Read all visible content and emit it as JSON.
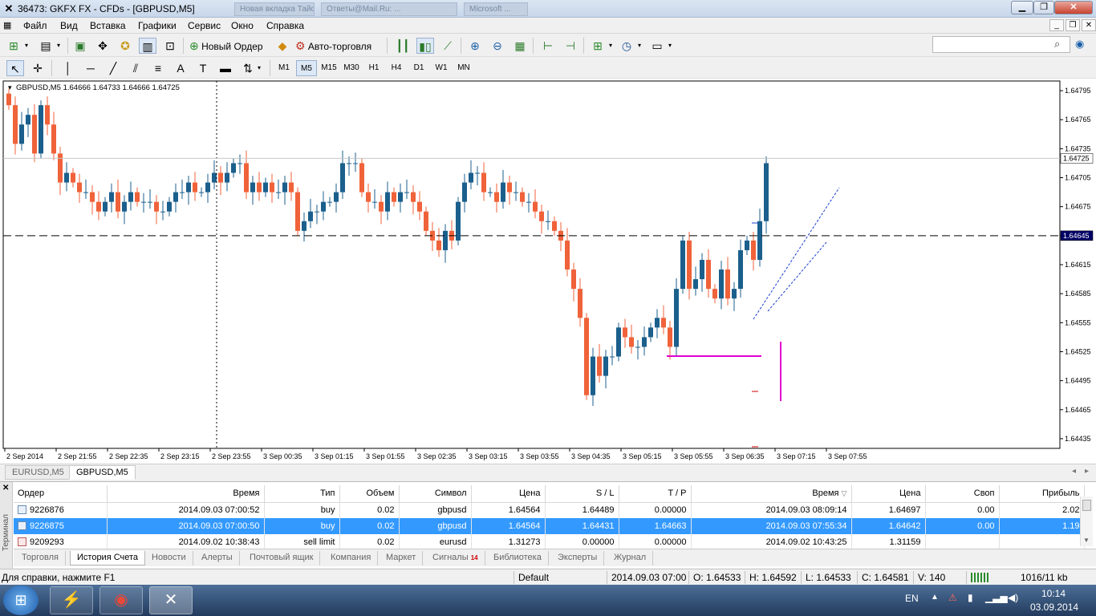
{
  "window": {
    "title": "36473: GKFX FX - CFDs - [GBPUSD,M5]",
    "icon": "metatrader-icon",
    "bg_tab_1": "Новая вкладка Тайфун...",
    "bg_tab_2": "Ответы@Mail.Ru: ...",
    "bg_tab_3": "Microsoft ..."
  },
  "menu": [
    "Файл",
    "Вид",
    "Вставка",
    "Графики",
    "Сервис",
    "Окно",
    "Справка"
  ],
  "toolbar": {
    "new_order": "Новый Ордер",
    "auto_trading": "Авто-торговля"
  },
  "timeframes": [
    "M1",
    "M5",
    "M15",
    "M30",
    "H1",
    "H4",
    "D1",
    "W1",
    "MN"
  ],
  "active_timeframe": "M5",
  "search": {
    "placeholder": ""
  },
  "chart_header": "GBPUSD,M5  1.64666 1.64733 1.64666 1.64725",
  "chart_data": {
    "type": "candlestick",
    "symbol": "GBPUSD",
    "timeframe": "M5",
    "ohlc_header": {
      "open": 1.64666,
      "high": 1.64733,
      "low": 1.64666,
      "close": 1.64725
    },
    "ylim": [
      1.64425,
      1.64805
    ],
    "y_ticks": [
      1.64795,
      1.64765,
      1.64735,
      1.64705,
      1.64675,
      1.64645,
      1.64615,
      1.64585,
      1.64555,
      1.64525,
      1.64495,
      1.64465,
      1.64435
    ],
    "x_ticks": [
      "2 Sep 2014",
      "2 Sep 21:55",
      "2 Sep 22:35",
      "2 Sep 23:15",
      "2 Sep 23:55",
      "3 Sep 00:35",
      "3 Sep 01:15",
      "3 Sep 01:55",
      "3 Sep 02:35",
      "3 Sep 03:15",
      "3 Sep 03:55",
      "3 Sep 04:35",
      "3 Sep 05:15",
      "3 Sep 05:55",
      "3 Sep 06:35",
      "3 Sep 07:15",
      "3 Sep 07:55"
    ],
    "current_price": 1.64725,
    "hline_price": 1.64645,
    "current_price_label": "1.64725",
    "hline_label": "1.64645",
    "bull_color": "#1b5f8c",
    "bear_color": "#f0623a",
    "closes": [
      1.6478,
      1.6474,
      1.6476,
      1.6477,
      1.6473,
      1.6478,
      1.6476,
      1.6473,
      1.647,
      1.6471,
      1.647,
      1.6469,
      1.6469,
      1.6468,
      1.6467,
      1.6468,
      1.6469,
      1.6467,
      1.6468,
      1.6469,
      1.6468,
      1.6468,
      1.6468,
      1.6467,
      1.6467,
      1.6468,
      1.6469,
      1.6469,
      1.647,
      1.6469,
      1.6469,
      1.647,
      1.6471,
      1.647,
      1.6471,
      1.6472,
      1.6472,
      1.6469,
      1.647,
      1.6469,
      1.647,
      1.6469,
      1.6469,
      1.647,
      1.6469,
      1.6465,
      1.6466,
      1.6467,
      1.6467,
      1.6468,
      1.6468,
      1.6469,
      1.6472,
      1.6472,
      1.6472,
      1.6469,
      1.6468,
      1.6468,
      1.6467,
      1.6469,
      1.6468,
      1.6469,
      1.6469,
      1.6468,
      1.6467,
      1.6465,
      1.6464,
      1.6463,
      1.6465,
      1.6464,
      1.6468,
      1.647,
      1.6471,
      1.6471,
      1.6469,
      1.6469,
      1.6468,
      1.647,
      1.6469,
      1.6469,
      1.6468,
      1.6468,
      1.6467,
      1.6466,
      1.6466,
      1.6465,
      1.6464,
      1.6461,
      1.6459,
      1.6456,
      1.6448,
      1.6452,
      1.645,
      1.6452,
      1.6452,
      1.6455,
      1.6454,
      1.6453,
      1.6453,
      1.6454,
      1.6455,
      1.6456,
      1.6455,
      1.6453,
      1.6459,
      1.6464,
      1.6459,
      1.646,
      1.6462,
      1.6459,
      1.6458,
      1.6461,
      1.6458,
      1.6459,
      1.6463,
      1.6464,
      1.6462,
      1.6466,
      1.6472
    ]
  },
  "chart_tabs": [
    "EURUSD,M5",
    "GBPUSD,M5"
  ],
  "active_chart_tab": 1,
  "orders": {
    "headers": [
      "Ордер",
      "Время",
      "Тип",
      "Объем",
      "Символ",
      "Цена",
      "S / L",
      "T / P",
      "Время",
      "Цена",
      "Своп",
      "Прибыль"
    ],
    "rows": [
      [
        "9226876",
        "2014.09.03 07:00:52",
        "buy",
        "0.02",
        "gbpusd",
        "1.64564",
        "1.64489",
        "0.00000",
        "2014.09.03 08:09:14",
        "1.64697",
        "0.00",
        "2.02"
      ],
      [
        "9226875",
        "2014.09.03 07:00:50",
        "buy",
        "0.02",
        "gbpusd",
        "1.64564",
        "1.64431",
        "1.64663",
        "2014.09.03 07:55:34",
        "1.64642",
        "0.00",
        "1.19"
      ],
      [
        "9209293",
        "2014.09.02 10:38:43",
        "sell limit",
        "0.02",
        "eurusd",
        "1.31273",
        "0.00000",
        "0.00000",
        "2014.09.02 10:43:25",
        "1.31159",
        "",
        ""
      ]
    ]
  },
  "terminal_label": "Терминал",
  "terminal_tabs": [
    "Торговля",
    "История Счета",
    "Новости",
    "Алерты",
    "Почтовый ящик",
    "Компания",
    "Маркет",
    "Сигналы",
    "Библиотека",
    "Эксперты",
    "Журнал"
  ],
  "signals_badge": "14",
  "status": {
    "help": "Для справки, нажмите F1",
    "profile": "Default",
    "time": "2014.09.03 07:00",
    "open": "O: 1.64533",
    "high": "H: 1.64592",
    "low": "L: 1.64533",
    "close": "C: 1.64581",
    "volume": "V: 140",
    "traffic": "1016/11 kb"
  },
  "tray": {
    "lang": "EN",
    "time": "10:14",
    "date": "03.09.2014"
  }
}
